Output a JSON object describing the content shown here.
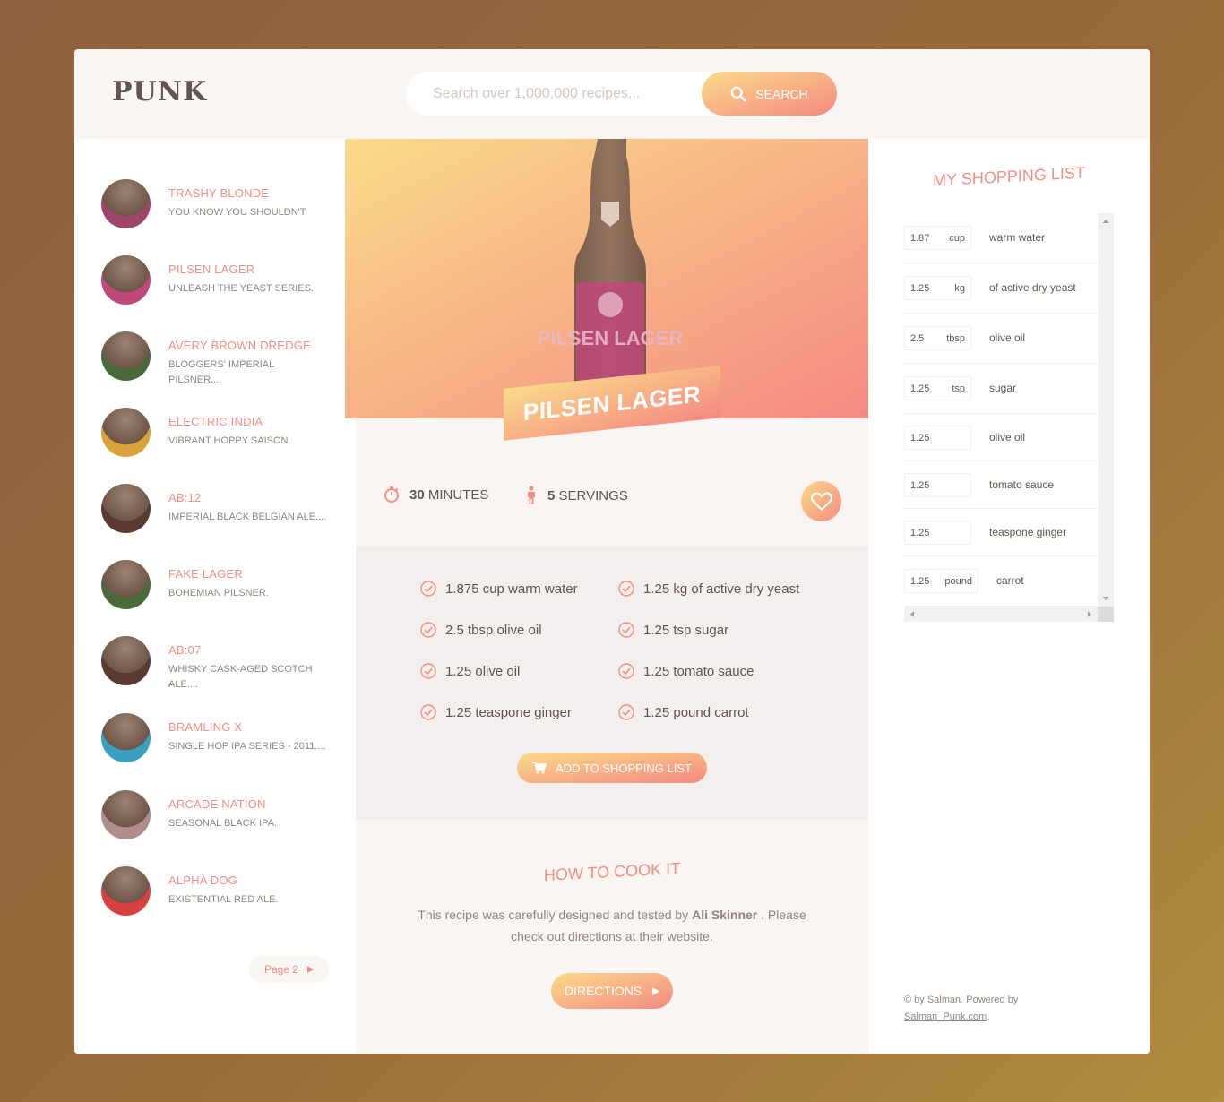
{
  "header": {
    "logo": "PUNK",
    "search_placeholder": "Search over 1,000,000 recipes...",
    "search_label": "Search"
  },
  "results": [
    {
      "title": "Trashy Blonde",
      "subtitle": "You Know You Shouldn't",
      "color": "#a0456a"
    },
    {
      "title": "Pilsen Lager",
      "subtitle": "Unleash the Yeast Series.",
      "color": "#c0487a"
    },
    {
      "title": "Avery Brown Dredge",
      "subtitle": "Bloggers' Imperial Pilsner....",
      "color": "#4a6a3a"
    },
    {
      "title": "Electric India",
      "subtitle": "Vibrant Hoppy Saison.",
      "color": "#d9a23a"
    },
    {
      "title": "AB:12",
      "subtitle": "Imperial Black Belgian Ale....",
      "color": "#5a3a30"
    },
    {
      "title": "Fake Lager",
      "subtitle": "Bohemian Pilsner.",
      "color": "#4a6a3a"
    },
    {
      "title": "AB:07",
      "subtitle": "Whisky Cask-Aged Scotch Ale....",
      "color": "#5a3a30"
    },
    {
      "title": "Bramling X",
      "subtitle": "Single Hop IPA Series - 2011....",
      "color": "#3aa0c0"
    },
    {
      "title": "Arcade Nation",
      "subtitle": "Seasonal Black IPA.",
      "color": "#b08c8a"
    },
    {
      "title": "Alpha Dog",
      "subtitle": "Existential Red Ale.",
      "color": "#d84040"
    }
  ],
  "pagination": {
    "label": "Page 2"
  },
  "recipe": {
    "title": "Pilsen Lager",
    "bottle_label": "PILSEN LAGER",
    "minutes": "30",
    "minutes_unit": "minutes",
    "servings": "5",
    "servings_unit": "servings",
    "ingredients": [
      "1.875 cup warm water",
      "1.25 kg of active dry yeast",
      "2.5 tbsp olive oil",
      "1.25 tsp sugar",
      "1.25 olive oil",
      "1.25 tomato sauce",
      "1.25 teaspone ginger",
      "1.25 pound carrot"
    ],
    "add_label": "Add to shopping list",
    "how_to_title": "How to cook it",
    "how_to_text_1": "This recipe was carefully designed and tested by",
    "author": "Ali Skinner",
    "how_to_text_2": ". Please check out directions at their website.",
    "directions_label": "Directions"
  },
  "shopping": {
    "title": "My Shopping List",
    "items": [
      {
        "count": "1.87",
        "unit": "cup",
        "desc": "warm water"
      },
      {
        "count": "1.25",
        "unit": "kg",
        "desc": "of active dry yeast"
      },
      {
        "count": "2.5",
        "unit": "tbsp",
        "desc": "olive oil"
      },
      {
        "count": "1.25",
        "unit": "tsp",
        "desc": "sugar"
      },
      {
        "count": "1.25",
        "unit": "",
        "desc": "olive oil"
      },
      {
        "count": "1.25",
        "unit": "",
        "desc": "tomato sauce"
      },
      {
        "count": "1.25",
        "unit": "",
        "desc": "teaspone ginger"
      },
      {
        "count": "1.25",
        "unit": "pound",
        "desc": "carrot"
      }
    ]
  },
  "footer": {
    "copyright": "© by Salman. Powered by",
    "link": "Salman_Punk.com",
    "period": "."
  },
  "colors": {
    "accent": "#f38e82",
    "gradient_start": "#fbdb89",
    "gradient_end": "#f48982",
    "text": "#615551",
    "text_light": "#918581",
    "bg_light": "#f9f5f3",
    "bg_grey": "#f2efee"
  }
}
